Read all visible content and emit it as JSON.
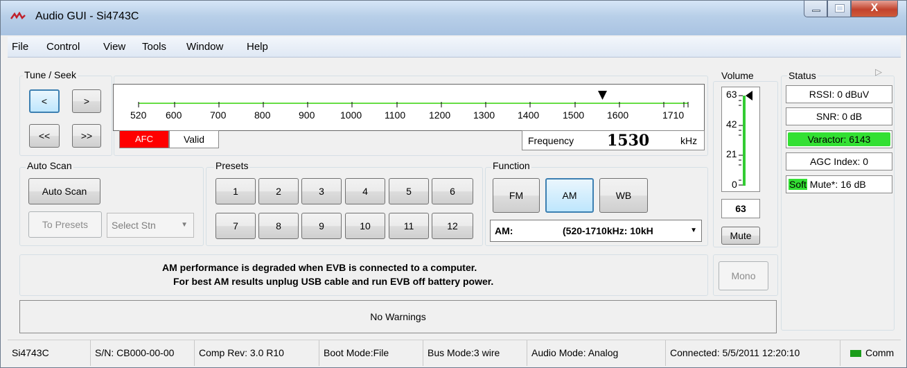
{
  "window": {
    "title": "Audio GUI - Si4743C",
    "close_label": "X"
  },
  "menu": [
    "File",
    "Control",
    "View",
    "Tools",
    "Window",
    "Help"
  ],
  "tune_seek": {
    "label": "Tune / Seek",
    "prev": "<",
    "next": ">",
    "seek_down": "<<",
    "seek_up": ">>"
  },
  "scale": {
    "ticks": [
      "520",
      "600",
      "700",
      "800",
      "900",
      "1000",
      "1100",
      "1200",
      "1300",
      "1400",
      "1500",
      "1600",
      "1710"
    ],
    "afc": "AFC",
    "valid": "Valid"
  },
  "frequency": {
    "label": "Frequency",
    "value": "1530",
    "unit": "kHz"
  },
  "auto_scan": {
    "label": "Auto Scan",
    "button": "Auto Scan",
    "to_presets": "To Presets",
    "select_stn": "Select Stn"
  },
  "presets": {
    "label": "Presets",
    "row1": [
      "1",
      "2",
      "3",
      "4",
      "5",
      "6"
    ],
    "row2": [
      "7",
      "8",
      "9",
      "10",
      "11",
      "12"
    ]
  },
  "function": {
    "label": "Function",
    "fm": "FM",
    "am": "AM",
    "wb": "WB",
    "band_prefix": "AM:",
    "band_range": "(520-1710kHz: 10kH"
  },
  "message": {
    "line1": "AM performance is degraded when EVB is connected to a computer.",
    "line2": "For best AM results unplug USB cable and run EVB off battery power."
  },
  "warnings": "No Warnings",
  "volume": {
    "label": "Volume",
    "ticks": [
      "63",
      "42",
      "21",
      "0"
    ],
    "value": "63",
    "mute": "Mute",
    "level_fraction": 1.0
  },
  "mono": "Mono",
  "status": {
    "label": "Status",
    "rssi": "RSSI: 0 dBuV",
    "snr": "SNR: 0 dB",
    "varactor": "Varactor: 6143",
    "agc": "AGC Index: 0",
    "softmute_highlight": "Soft",
    "softmute_rest": " Mute*: 16 dB",
    "accent_green": "#33e033"
  },
  "statusbar": {
    "chip": "Si4743C",
    "serial": "S/N: CB000-00-00",
    "comp_rev": "Comp Rev: 3.0 R10",
    "boot_mode": "Boot Mode:File",
    "bus_mode": "Bus Mode:3 wire",
    "audio_mode": "Audio Mode: Analog",
    "connected": "Connected: 5/5/2011 12:20:10",
    "comm": "Comm"
  }
}
